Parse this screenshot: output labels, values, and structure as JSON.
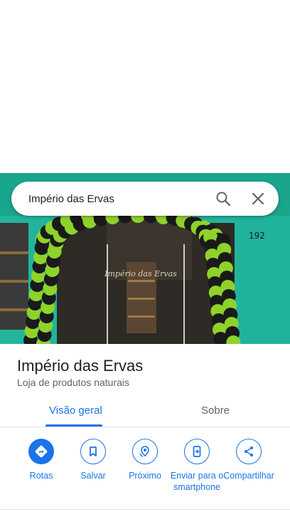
{
  "search": {
    "query": "Império das Ervas",
    "search_icon": "search-icon",
    "clear_icon": "close-icon"
  },
  "photo": {
    "sign_text": "Império das Ervas",
    "address_number": "192"
  },
  "place": {
    "name": "Império das Ervas",
    "category": "Loja de produtos naturais"
  },
  "tabs": [
    {
      "label": "Visão geral",
      "selected": true
    },
    {
      "label": "Sobre",
      "selected": false
    }
  ],
  "actions": [
    {
      "label": "Rotas",
      "icon": "directions-icon"
    },
    {
      "label": "Salvar",
      "icon": "bookmark-icon"
    },
    {
      "label": "Próximo",
      "icon": "nearby-icon"
    },
    {
      "label": "Enviar para o smartphone",
      "icon": "send-to-phone-icon"
    },
    {
      "label": "Compartilhar",
      "icon": "share-icon"
    }
  ],
  "colors": {
    "accent": "#1a73e8",
    "storefront": "#1fb39a",
    "balloon_green": "#8fd22a",
    "balloon_black": "#1a1a1a"
  }
}
